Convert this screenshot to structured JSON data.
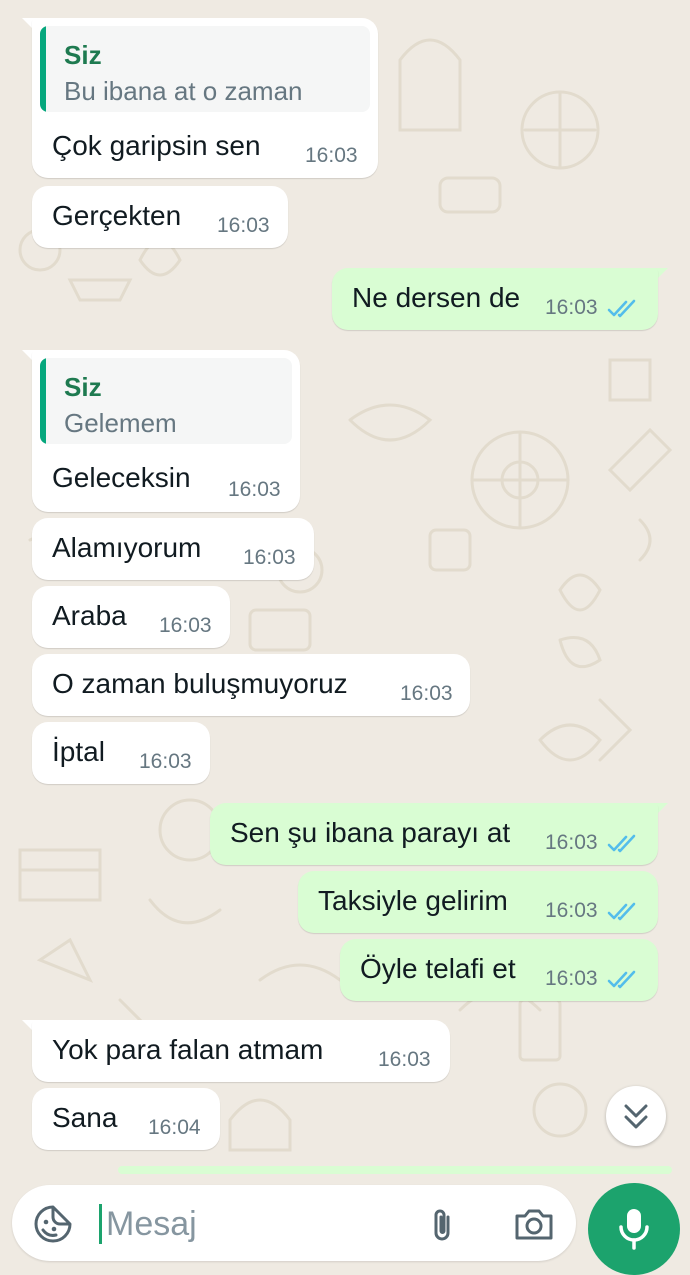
{
  "colors": {
    "wallpaper": "#efeae2",
    "incoming_bubble": "#ffffff",
    "outgoing_bubble": "#d9fdd3",
    "accent_green": "#1ca36d",
    "read_tick_blue": "#53bdeb"
  },
  "messages": [
    {
      "direction": "incoming",
      "text": "Çok garipsin sen",
      "time": "16:03",
      "quote": {
        "author": "Siz",
        "text": "Bu ibana at o zaman"
      }
    },
    {
      "direction": "incoming",
      "text": "Gerçekten",
      "time": "16:03"
    },
    {
      "direction": "outgoing",
      "text": "Ne dersen de",
      "time": "16:03",
      "status": "read"
    },
    {
      "direction": "incoming",
      "text": "Geleceksin",
      "time": "16:03",
      "quote": {
        "author": "Siz",
        "text": "Gelemem"
      }
    },
    {
      "direction": "incoming",
      "text": "Alamıyorum",
      "time": "16:03"
    },
    {
      "direction": "incoming",
      "text": "Araba",
      "time": "16:03"
    },
    {
      "direction": "incoming",
      "text": "O zaman buluşmuyoruz",
      "time": "16:03"
    },
    {
      "direction": "incoming",
      "text": "İptal",
      "time": "16:03"
    },
    {
      "direction": "outgoing",
      "text": "Sen şu ibana parayı at",
      "time": "16:03",
      "status": "read"
    },
    {
      "direction": "outgoing",
      "text": "Taksiyle gelirim",
      "time": "16:03",
      "status": "read"
    },
    {
      "direction": "outgoing",
      "text": "Öyle telafi et",
      "time": "16:03",
      "status": "read"
    },
    {
      "direction": "incoming",
      "text": "Yok para falan atmam",
      "time": "16:03"
    },
    {
      "direction": "incoming",
      "text": "Sana",
      "time": "16:04"
    }
  ],
  "composer": {
    "placeholder": "Mesaj",
    "emoji_icon": "sticker-icon",
    "attach_icon": "paperclip-icon",
    "camera_icon": "camera-icon",
    "send_icon": "microphone-icon"
  },
  "scroll_button": {
    "icon": "double-chevron-down-icon"
  }
}
